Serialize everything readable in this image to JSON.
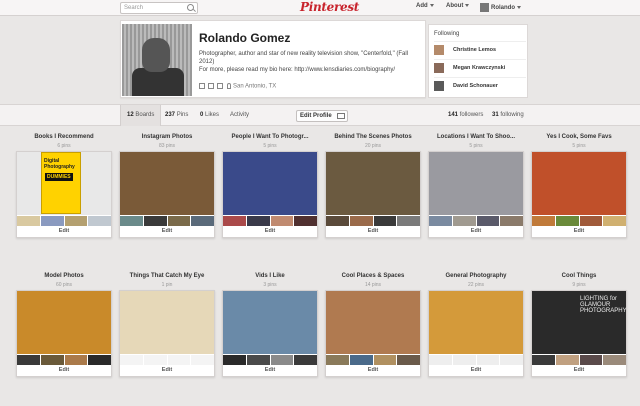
{
  "header": {
    "search_placeholder": "Search",
    "logo": "Pinterest",
    "nav": {
      "add": "Add",
      "about": "About",
      "user": "Rolando"
    }
  },
  "profile": {
    "name": "Rolando Gomez",
    "bio_line1": "Photographer, author and star of new reality television show, \"Centerfold,\" (Fall 2012)",
    "bio_line2": "For more, please read my bio here: http://www.lensdiaries.com/biography/",
    "location": "San Antonio, TX"
  },
  "following": {
    "title": "Following",
    "people": [
      "Christine Lemos",
      "Megan Krawczynski",
      "David Schonauer"
    ]
  },
  "stats": {
    "boards": {
      "count": "12",
      "label": "Boards"
    },
    "pins": {
      "count": "237",
      "label": "Pins"
    },
    "likes": {
      "count": "0",
      "label": "Likes"
    },
    "activity": "Activity",
    "edit_profile": "Edit Profile",
    "followers": {
      "count": "141",
      "label": "followers"
    },
    "following": {
      "count": "31",
      "label": "following"
    }
  },
  "boards": [
    {
      "title": "Books I Recommend",
      "pins": "6 pins",
      "edit": "Edit",
      "cover": "#e8e8e8",
      "book_title": "Digital Photography",
      "book_sub": "DUMMIES"
    },
    {
      "title": "Instagram Photos",
      "pins": "83 pins",
      "edit": "Edit",
      "cover": "#7a5a38"
    },
    {
      "title": "People I Want To Photogr...",
      "pins": "5 pins",
      "edit": "Edit",
      "cover": "#3a4a8a"
    },
    {
      "title": "Behind The Scenes Photos",
      "pins": "20 pins",
      "edit": "Edit",
      "cover": "#6b5a40"
    },
    {
      "title": "Locations I Want To Shoo...",
      "pins": "5 pins",
      "edit": "Edit",
      "cover": "#9a9aa0"
    },
    {
      "title": "Yes I Cook, Some Favs",
      "pins": "5 pins",
      "edit": "Edit",
      "cover": "#c0502a"
    },
    {
      "title": "Model Photos",
      "pins": "60 pins",
      "edit": "Edit",
      "cover": "#c98a2a"
    },
    {
      "title": "Things That Catch My Eye",
      "pins": "1 pin",
      "edit": "Edit",
      "cover": "#e6d8b8"
    },
    {
      "title": "Vids I Like",
      "pins": "3 pins",
      "edit": "Edit",
      "cover": "#6a8aa8"
    },
    {
      "title": "Cool Places & Spaces",
      "pins": "14 pins",
      "edit": "Edit",
      "cover": "#b07a50"
    },
    {
      "title": "General Photography",
      "pins": "22 pins",
      "edit": "Edit",
      "cover": "#d49a3a"
    },
    {
      "title": "Cool Things",
      "pins": "9 pins",
      "edit": "Edit",
      "cover": "#2a2a2a",
      "book_title": "LIGHTING for GLAMOUR PHOTOGRAPHY"
    }
  ]
}
